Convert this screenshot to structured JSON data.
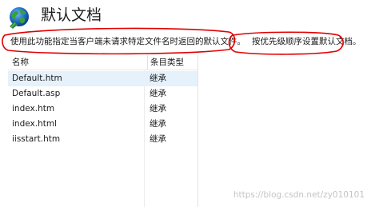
{
  "header": {
    "title": "默认文档",
    "icon": "globe-icon"
  },
  "description": {
    "part1": "使用此功能指定当客户端未请求特定文件名时返回的默认文件。",
    "part2": "按优先级顺序设置默认文档。"
  },
  "list": {
    "columns": {
      "name": "名称",
      "entry_type": "条目类型"
    },
    "rows": [
      {
        "name": "Default.htm",
        "entry_type": "继承"
      },
      {
        "name": "Default.asp",
        "entry_type": "继承"
      },
      {
        "name": "index.htm",
        "entry_type": "继承"
      },
      {
        "name": "index.html",
        "entry_type": "继承"
      },
      {
        "name": "iisstart.htm",
        "entry_type": "继承"
      }
    ]
  },
  "watermark": "https://blog.csdn.net/zy010101",
  "colors": {
    "annotation": "#e00000",
    "selection": "#e5f1fb"
  }
}
